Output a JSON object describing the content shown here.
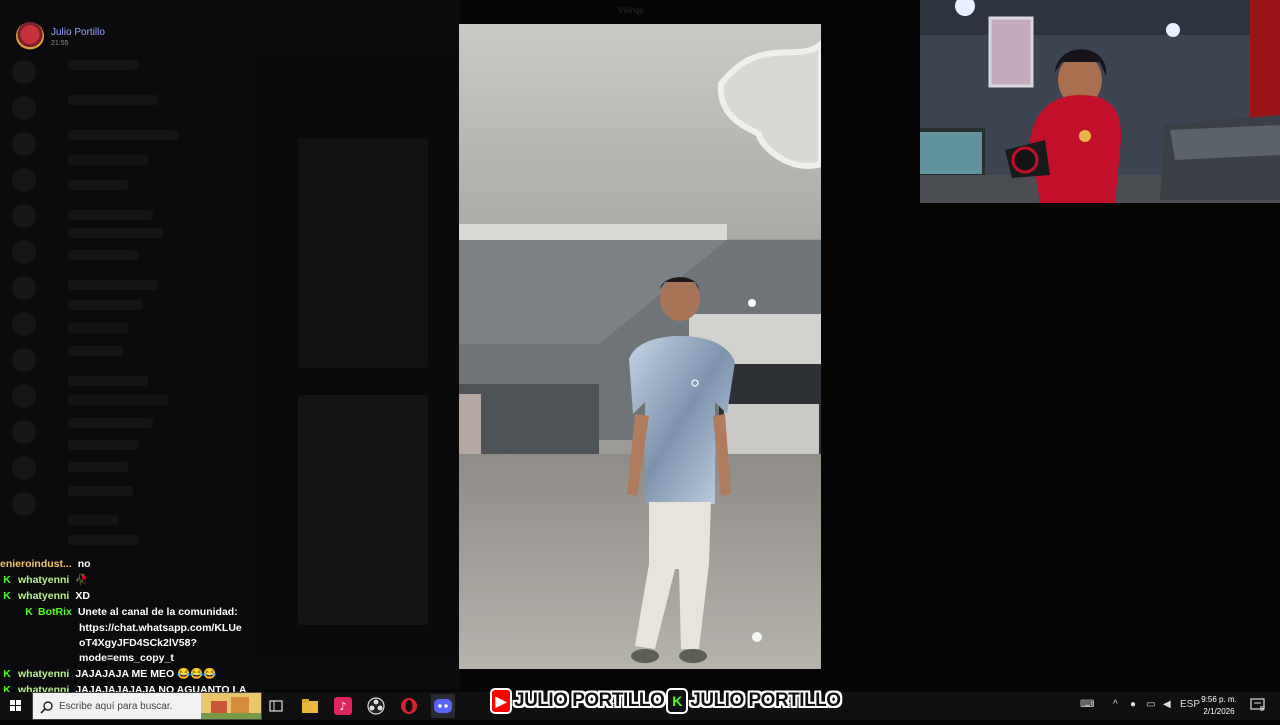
{
  "window_title": "Vikings",
  "broadcaster": {
    "name": "Julio Portillo",
    "time": "21:55"
  },
  "chat": [
    {
      "user": "enieroindust...",
      "text": "no",
      "badge": false,
      "kind": "normal"
    },
    {
      "user": "whatyenni",
      "text": "🥀",
      "badge": true,
      "kind": "green"
    },
    {
      "user": "whatyenni",
      "text": "XD",
      "badge": true,
      "kind": "green"
    },
    {
      "user": "BotRix",
      "text": "Unete al canal de la comunidad:",
      "badge": true,
      "kind": "bot",
      "continuation": [
        "https://chat.whatsapp.com/KLUe",
        "oT4XgyJFD4SCk2lV58?",
        "mode=ems_copy_t"
      ]
    },
    {
      "user": "whatyenni",
      "text": "JAJAJAJA ME MEO 😂😂😂",
      "badge": true,
      "kind": "green"
    },
    {
      "user": "whatyenni",
      "text": "JAJAJAJAJAJA NO AGUANTO LA",
      "badge": true,
      "kind": "green"
    }
  ],
  "taskbar": {
    "search_placeholder": "Escribe aquí para buscar.",
    "language": "ESP",
    "time": "9:56 p. m.",
    "date": "2/1/2026",
    "notification_count": "5",
    "icons": [
      "windows-icon",
      "search-icon",
      "task-view-icon",
      "file-explorer-icon",
      "tiktok-icon",
      "obs-icon",
      "opera-icon",
      "discord-icon"
    ]
  },
  "brand": {
    "items": [
      {
        "platform": "youtube",
        "label": "JULIO PORTILLO",
        "color": "#ff0000",
        "logo": "▶"
      },
      {
        "platform": "kick",
        "label": "JULIO PORTILLO",
        "color": "#53fc18",
        "logo": "K"
      }
    ]
  },
  "colors": {
    "accent_kick": "#53fc18",
    "accent_youtube": "#ff0000",
    "username": "#f0c36a"
  }
}
